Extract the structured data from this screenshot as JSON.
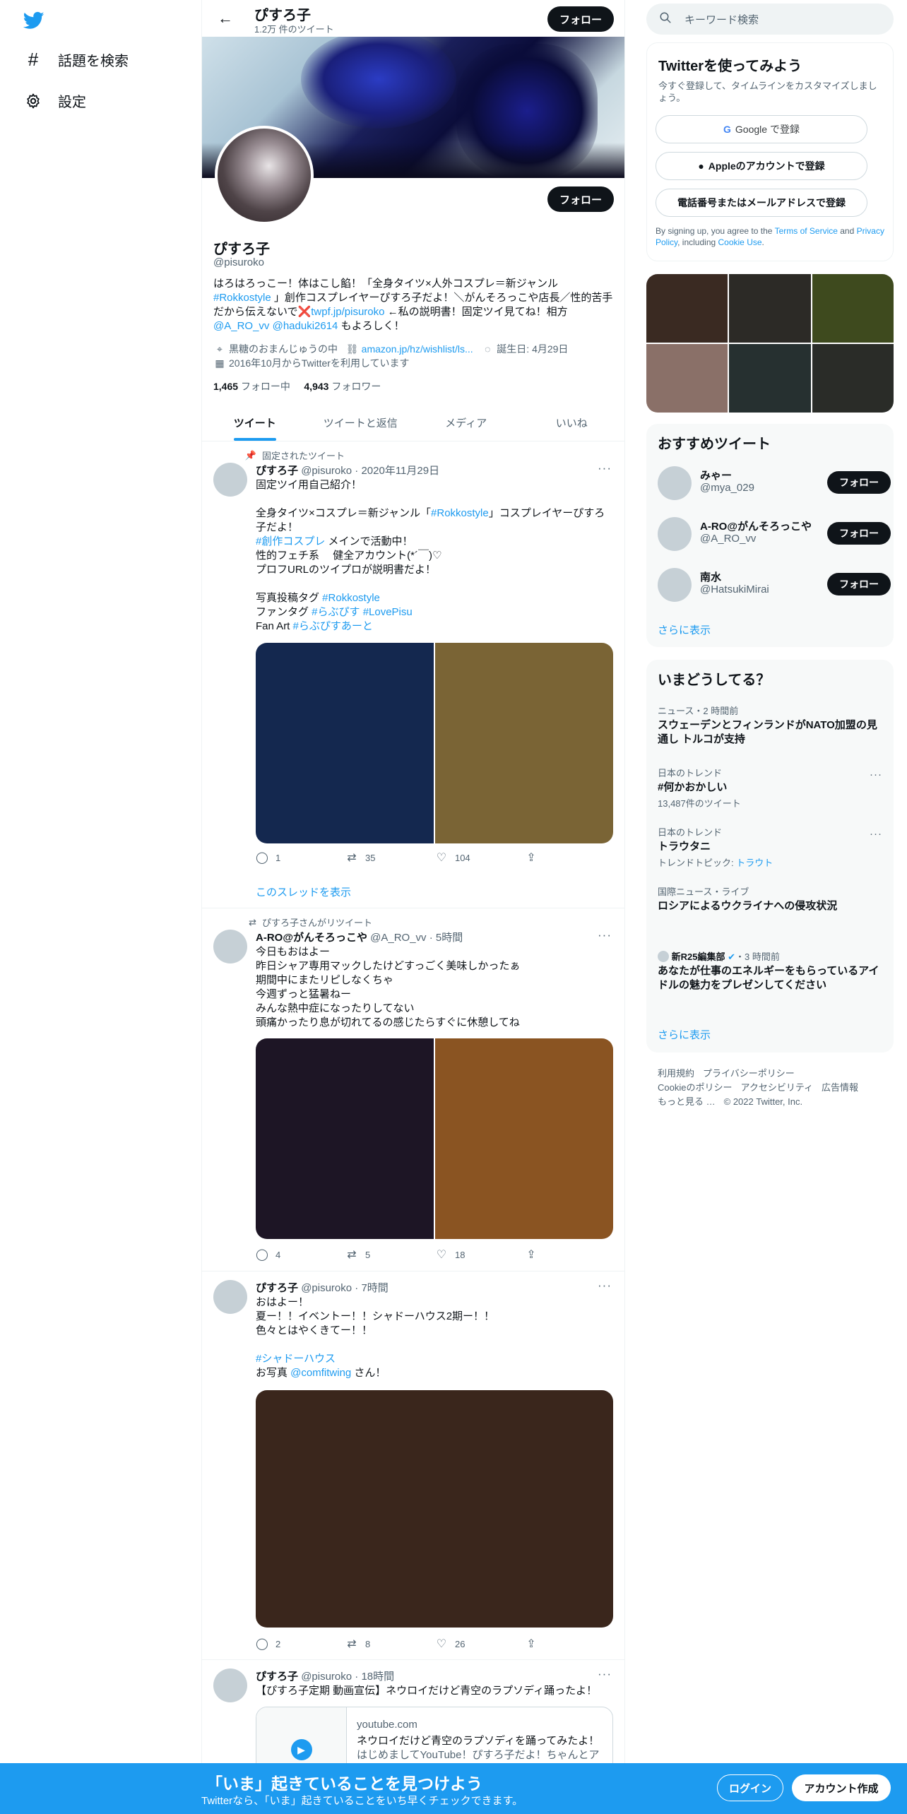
{
  "nav": {
    "explore": "話題を検索",
    "settings": "設定"
  },
  "header": {
    "name": "ぴすろ子",
    "tweet_count": "1.2万 件のツイート",
    "follow": "フォロー"
  },
  "profile": {
    "name": "ぴすろ子",
    "handle": "@pisuroko",
    "follow": "フォロー",
    "bio_1": "はろはろっこー！体はこし餡！「全身タイツ×人外コスプレ＝新ジャンル",
    "bio_tag": "#Rokkostyle",
    "bio_2": " 」創作コスプレイヤーぴすろ子だよ！＼がんそろっこや店長／性的苦手だから伝えないで",
    "bio_x": "❌",
    "bio_link": "twpf.jp/pisuroko",
    "bio_3": " ←私の説明書！固定ツイ見てね！相方",
    "bio_m1": "@A_RO_vv",
    "bio_m2": "@haduki2614",
    "bio_4": " もよろしく！",
    "location": "黒糖のおまんじゅうの中",
    "website": "amazon.jp/hz/wishlist/ls...",
    "birthday": "誕生日: 4月29日",
    "joined": "2016年10月からTwitterを利用しています",
    "following_count": "1,465",
    "following_label": "フォロー中",
    "followers_count": "4,943",
    "followers_label": "フォロワー"
  },
  "tabs": [
    "ツイート",
    "ツイートと返信",
    "メディア",
    "いいね"
  ],
  "tweets": [
    {
      "context": "固定されたツイート",
      "name": "ぴすろ子",
      "handle": "@pisuroko",
      "time": "· 2020年11月29日",
      "text_a": "固定ツイ用自己紹介！\n\n全身タイツ×コスプレ＝新ジャンル「",
      "tag_1": "#Rokkostyle",
      "text_b": "」コスプレイヤーぴすろ子だよ！\n",
      "tag_2": "#創作コスプレ",
      "text_c": " メインで活動中！\n性的フェチ系　 健全アカウント(*´￣)♡\nプロフURLのツイプロが説明書だよ！\n\n写真投稿タグ ",
      "tag_3": "#Rokkostyle",
      "text_d": "\nファンタグ ",
      "tag_4": "#らぶぴす",
      "text_e": " ",
      "tag_5": "#LovePisu",
      "text_f": "\nFan Art ",
      "tag_6": "#らぶぴすあーと",
      "replies": "1",
      "retweets": "35",
      "likes": "104",
      "show_thread": "このスレッドを表示"
    },
    {
      "context": "ぴすろ子さんがリツイート",
      "name": "A-RO@がんそろっこや",
      "handle": "@A_RO_vv",
      "time": "· 5時間",
      "text": "今日もおはよー\n昨日シャア専用マックしたけどすっごく美味しかったぁ\n期間中にまたリピしなくちゃ\n今週ずっと猛暑ねー\nみんな熱中症になったりしてない\n頭痛かったり息が切れてるの感じたらすぐに休憩してね",
      "replies": "4",
      "retweets": "5",
      "likes": "18"
    },
    {
      "name": "ぴすろ子",
      "handle": "@pisuroko",
      "time": "· 7時間",
      "text_a": "おはよー！\n夏ー！！イベントー！！シャドーハウス2期ー！！\n色々とはやくきてー！！\n\n",
      "tag_1": "#シャドーハウス",
      "text_b": "\nお写真 ",
      "mention": "@comfitwing",
      "text_c": " さん！",
      "replies": "2",
      "retweets": "8",
      "likes": "26"
    },
    {
      "name": "ぴすろ子",
      "handle": "@pisuroko",
      "time": "· 18時間",
      "text": "【ぴすろ子定期 動画宣伝】ネウロイだけど青空のラプソディ踊ったよ！",
      "card_domain": "youtube.com",
      "card_title": "ネウロイだけど青空のラプソディを踊ってみたよ！",
      "card_desc": "はじめましてYouTube！ぴすろ子だよ！ちゃんとア"
    }
  ],
  "right": {
    "search_placeholder": "キーワード検索",
    "signup": {
      "title": "Twitterを使ってみよう",
      "subtitle": "今すぐ登録して、タイムラインをカスタマイズしましょう。",
      "google": "Google で登録",
      "apple": "Appleのアカウントで登録",
      "phone": "電話番号またはメールアドレスで登録",
      "terms_1": "By signing up, you agree to the ",
      "terms_tos": "Terms of Service",
      "terms_2": " and ",
      "terms_pp": "Privacy Policy",
      "terms_3": ", including ",
      "terms_cookie": "Cookie Use",
      "terms_4": "."
    },
    "gallery_colors": [
      "#3a2a22",
      "#2c2a26",
      "#3e4a1e",
      "#8a7068",
      "#263030",
      "#2a2c28"
    ],
    "who_to_follow": {
      "title": "おすすめツイート",
      "users": [
        {
          "name": "みゃー",
          "handle": "@mya_029",
          "follow": "フォロー"
        },
        {
          "name": "A-RO@がんそろっこや",
          "handle": "@A_RO_vv",
          "follow": "フォロー"
        },
        {
          "name": "南水",
          "handle": "@HatsukiMirai",
          "follow": "フォロー"
        }
      ],
      "more": "さらに表示"
    },
    "trends": {
      "title": "いまどうしてる？",
      "items": [
        {
          "context": "ニュース・2 時間前",
          "title": "スウェーデンとフィンランドがNATO加盟の見通し トルコが支持"
        },
        {
          "context": "日本のトレンド",
          "title": "#何かおかしい",
          "count": "13,487件のツイート"
        },
        {
          "context": "日本のトレンド",
          "title": "トラウタニ",
          "topic_label": "トレンドトピック: ",
          "topic": "トラウト"
        },
        {
          "context": "国際ニュース・ライブ",
          "title": "ロシアによるウクライナへの侵攻状況"
        },
        {
          "source": "新R25編集部",
          "time": "・3 時間前",
          "title": "あなたが仕事のエネルギーをもらっているアイドルの魅力をプレゼンしてください"
        }
      ],
      "more": "さらに表示"
    },
    "footer": {
      "terms": "利用規約",
      "privacy": "プライバシーポリシー",
      "cookie": "Cookieのポリシー",
      "accessibility": "アクセシビリティ",
      "ads": "広告情報",
      "more": "もっと見る …",
      "copyright": "© 2022 Twitter, Inc."
    }
  },
  "bottom_bar": {
    "title": "「いま」起きていることを見つけよう",
    "subtitle": "Twitterなら、「いま」起きていることをいち早くチェックできます。",
    "login": "ログイン",
    "signup": "アカウント作成"
  },
  "media_colors": {
    "t1": [
      "#14284f",
      "#7a6435"
    ],
    "t2": [
      "#1d1525",
      "#8a5422"
    ],
    "t3": [
      "#3a261c"
    ]
  },
  "colors": {
    "accent": "#1d9bf0",
    "text": "#0f1419",
    "muted": "#536471"
  }
}
